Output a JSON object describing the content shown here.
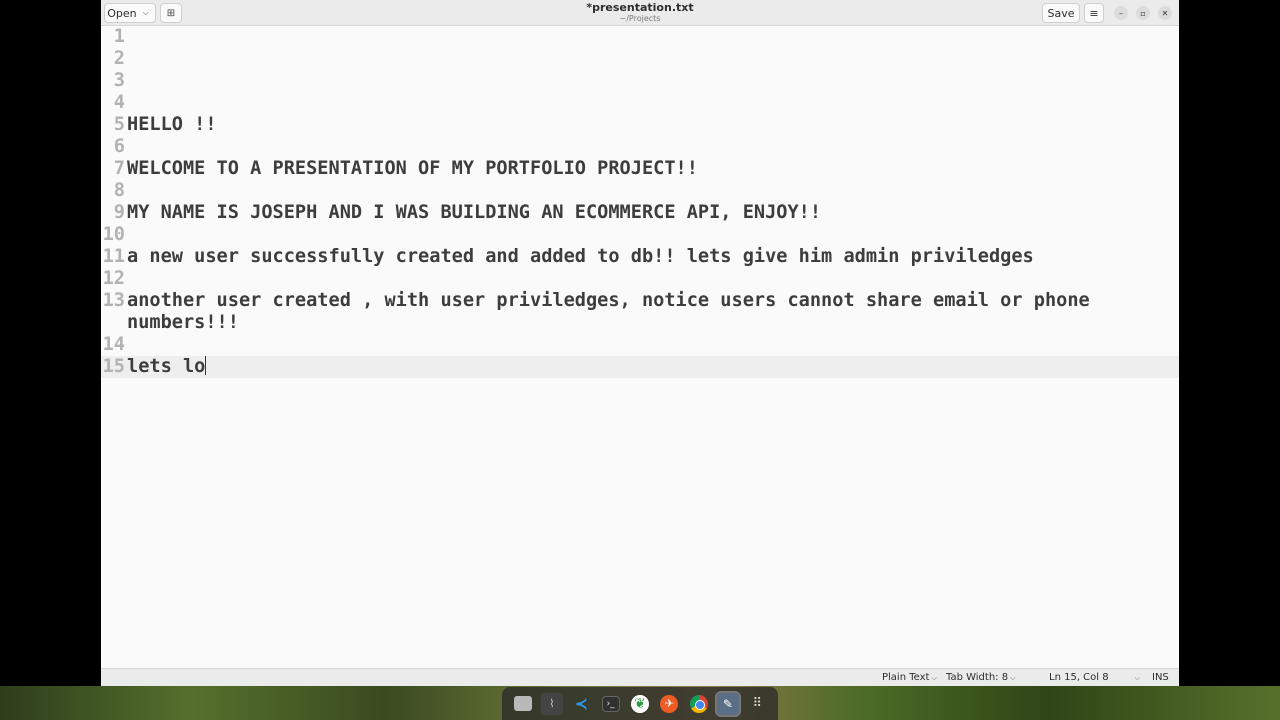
{
  "window": {
    "title": "*presentation.txt",
    "subtitle": "~/Projects"
  },
  "headerbar": {
    "open_label": "Open",
    "open_chevron": "⌵",
    "newtab_glyph": "⊞",
    "save_label": "Save",
    "menu_glyph": "≡",
    "minimize_glyph": "–",
    "maximize_glyph": "▫",
    "close_glyph": "✕"
  },
  "editor": {
    "lines": [
      {
        "num": "1",
        "text": ""
      },
      {
        "num": "2",
        "text": ""
      },
      {
        "num": "3",
        "text": ""
      },
      {
        "num": "4",
        "text": ""
      },
      {
        "num": "5",
        "text": "HELLO !!"
      },
      {
        "num": "6",
        "text": ""
      },
      {
        "num": "7",
        "text": "WELCOME TO A PRESENTATION OF MY PORTFOLIO PROJECT!!"
      },
      {
        "num": "8",
        "text": ""
      },
      {
        "num": "9",
        "text": "MY NAME IS JOSEPH AND I WAS BUILDING AN ECOMMERCE API, ENJOY!!"
      },
      {
        "num": "10",
        "text": ""
      },
      {
        "num": "11",
        "text": "a new user successfully created and added to db!! lets give him admin priviledges"
      },
      {
        "num": "12",
        "text": ""
      },
      {
        "num": "13",
        "text": "another user created , with user priviledges, notice users cannot share email or phone numbers!!!"
      },
      {
        "num": "14",
        "text": ""
      },
      {
        "num": "15",
        "text": "lets lo"
      }
    ],
    "current_line": 15
  },
  "statusbar": {
    "language": "Plain Text",
    "tab_width": "Tab Width: 8",
    "cursor_position": "Ln 15, Col 8",
    "insert_mode": "INS",
    "chevron": "⌵"
  },
  "dock": {
    "icons": [
      "files-icon",
      "system-monitor-icon",
      "vscode-icon",
      "terminal-icon",
      "mongodb-compass-icon",
      "postman-icon",
      "chrome-icon",
      "text-editor-icon",
      "app-grid-icon"
    ]
  },
  "colors": {
    "editor_bg": "#fafafa",
    "current_line_bg": "#eeeeee",
    "headerbar_bg": "#ebebeb",
    "text": "#3d3d3d",
    "line_numbers": "#b2b2b2"
  }
}
